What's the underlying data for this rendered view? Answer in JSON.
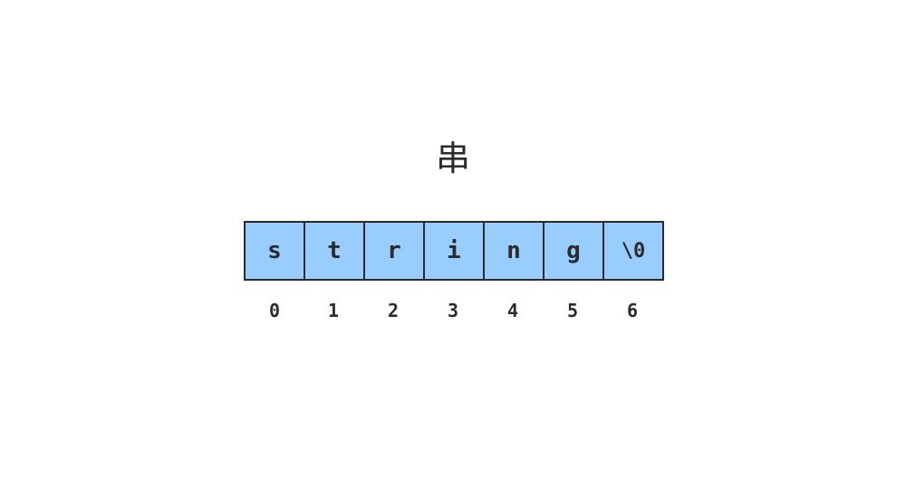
{
  "title": "串",
  "cells": [
    "s",
    "t",
    "r",
    "i",
    "n",
    "g",
    "\\0"
  ],
  "indices": [
    "0",
    "1",
    "2",
    "3",
    "4",
    "5",
    "6"
  ],
  "colors": {
    "cell_fill": "#99ccff",
    "border": "#2b2b2b",
    "text": "#2b2b2b"
  }
}
